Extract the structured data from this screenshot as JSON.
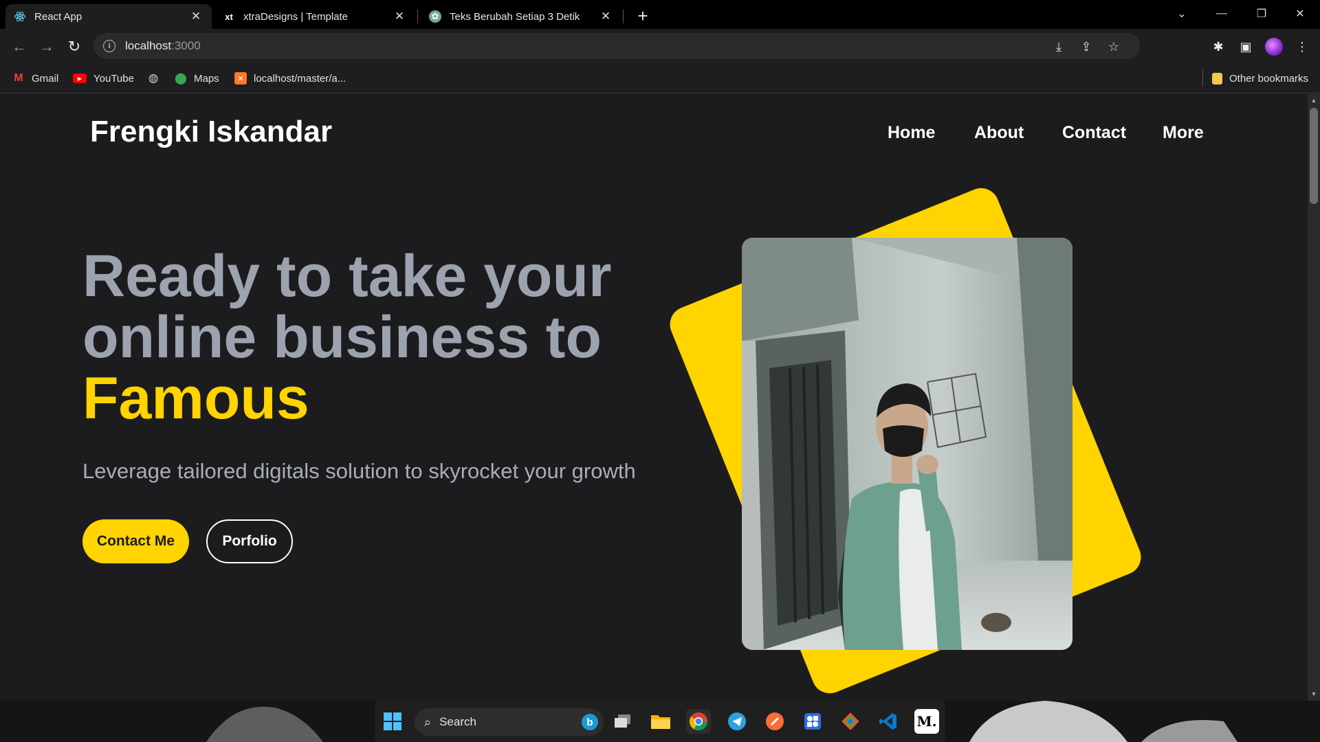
{
  "browser": {
    "tabs": [
      {
        "title": "React App",
        "active": true
      },
      {
        "title": "xtraDesigns | Template",
        "active": false
      },
      {
        "title": "Teks Berubah Setiap 3 Detik",
        "active": false
      }
    ],
    "address": {
      "host": "localhost",
      "port": ":3000"
    },
    "bookmarks": [
      {
        "label": "Gmail"
      },
      {
        "label": "YouTube"
      },
      {
        "label": ""
      },
      {
        "label": "Maps"
      },
      {
        "label": "localhost/master/a..."
      }
    ],
    "other_bookmarks": "Other bookmarks"
  },
  "page": {
    "brand": "Frengki Iskandar",
    "nav": [
      "Home",
      "About",
      "Contact",
      "More"
    ],
    "hero": {
      "line1": "Ready to take your",
      "line2": "online business to",
      "accent": "Famous",
      "subtitle": "Leverage tailored digitals solution to skyrocket your growth"
    },
    "buttons": {
      "primary": "Contact Me",
      "secondary": "Porfolio"
    },
    "colors": {
      "accent": "#ffd400",
      "background": "#1c1c1f",
      "hero_text": "#9ca3af"
    }
  },
  "taskbar": {
    "search_label": "Search",
    "icons": [
      "windows-start-icon",
      "bing-icon",
      "task-view-icon",
      "file-explorer-icon",
      "chrome-icon",
      "telegram-icon",
      "postman-icon",
      "app-grid-icon",
      "git-icon",
      "vscode-icon",
      "medium-icon"
    ]
  }
}
